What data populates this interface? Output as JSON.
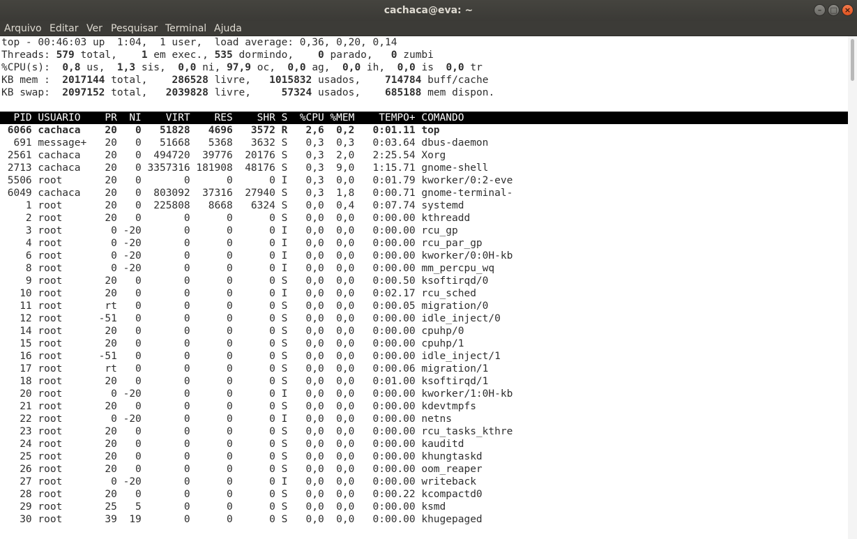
{
  "window": {
    "title": "cachaca@eva: ~",
    "buttons": [
      "minimize",
      "maximize",
      "close"
    ]
  },
  "menu": [
    "Arquivo",
    "Editar",
    "Ver",
    "Pesquisar",
    "Terminal",
    "Ajuda"
  ],
  "top_header": {
    "line1": "top - 00:46:03 up  1:04,  1 user,  load average: 0,36, 0,20, 0,14",
    "threads": {
      "label": "Threads:",
      "total": "579",
      "total_l": "total,",
      "running": "1",
      "running_l": "em exec.,",
      "sleeping": "535",
      "sleeping_l": "dormindo,",
      "stopped": "0",
      "stopped_l": "parado,",
      "zombie": "0",
      "zombie_l": "zumbi"
    },
    "cpu": {
      "label": "%CPU(s):",
      "us": "0,8",
      "sy": "1,3",
      "ni": "0,0",
      "id": "97,9",
      "wa": "0,0",
      "hi": "0,0",
      "si": "0,0",
      "st": "0,0"
    },
    "mem": {
      "label": "KB mem :",
      "total": "2017144",
      "free": "286528",
      "used": "1015832",
      "buff": "714784"
    },
    "swap": {
      "label": "KB swap:",
      "total": "2097152",
      "free": "2039828",
      "used": "57324",
      "avail": "685188"
    }
  },
  "columns": [
    "PID",
    "USUARIO",
    "PR",
    "NI",
    "VIRT",
    "RES",
    "SHR",
    "S",
    "%CPU",
    "%MEM",
    "TEMPO+",
    "COMANDO"
  ],
  "processes": [
    [
      "6066",
      "cachaca",
      "20",
      "0",
      "51828",
      "4696",
      "3572",
      "R",
      "2,6",
      "0,2",
      "0:01.11",
      "top"
    ],
    [
      "691",
      "message+",
      "20",
      "0",
      "51668",
      "5368",
      "3632",
      "S",
      "0,3",
      "0,3",
      "0:03.64",
      "dbus-daemon"
    ],
    [
      "2561",
      "cachaca",
      "20",
      "0",
      "494720",
      "39776",
      "20176",
      "S",
      "0,3",
      "2,0",
      "2:25.54",
      "Xorg"
    ],
    [
      "2713",
      "cachaca",
      "20",
      "0",
      "3357316",
      "181908",
      "48176",
      "S",
      "0,3",
      "9,0",
      "1:15.71",
      "gnome-shell"
    ],
    [
      "5506",
      "root",
      "20",
      "0",
      "0",
      "0",
      "0",
      "I",
      "0,3",
      "0,0",
      "0:01.79",
      "kworker/0:2-eve"
    ],
    [
      "6049",
      "cachaca",
      "20",
      "0",
      "803092",
      "37316",
      "27940",
      "S",
      "0,3",
      "1,8",
      "0:00.71",
      "gnome-terminal-"
    ],
    [
      "1",
      "root",
      "20",
      "0",
      "225808",
      "8668",
      "6324",
      "S",
      "0,0",
      "0,4",
      "0:07.74",
      "systemd"
    ],
    [
      "2",
      "root",
      "20",
      "0",
      "0",
      "0",
      "0",
      "S",
      "0,0",
      "0,0",
      "0:00.00",
      "kthreadd"
    ],
    [
      "3",
      "root",
      "0",
      "-20",
      "0",
      "0",
      "0",
      "I",
      "0,0",
      "0,0",
      "0:00.00",
      "rcu_gp"
    ],
    [
      "4",
      "root",
      "0",
      "-20",
      "0",
      "0",
      "0",
      "I",
      "0,0",
      "0,0",
      "0:00.00",
      "rcu_par_gp"
    ],
    [
      "6",
      "root",
      "0",
      "-20",
      "0",
      "0",
      "0",
      "I",
      "0,0",
      "0,0",
      "0:00.00",
      "kworker/0:0H-kb"
    ],
    [
      "8",
      "root",
      "0",
      "-20",
      "0",
      "0",
      "0",
      "I",
      "0,0",
      "0,0",
      "0:00.00",
      "mm_percpu_wq"
    ],
    [
      "9",
      "root",
      "20",
      "0",
      "0",
      "0",
      "0",
      "S",
      "0,0",
      "0,0",
      "0:00.50",
      "ksoftirqd/0"
    ],
    [
      "10",
      "root",
      "20",
      "0",
      "0",
      "0",
      "0",
      "I",
      "0,0",
      "0,0",
      "0:02.17",
      "rcu_sched"
    ],
    [
      "11",
      "root",
      "rt",
      "0",
      "0",
      "0",
      "0",
      "S",
      "0,0",
      "0,0",
      "0:00.05",
      "migration/0"
    ],
    [
      "12",
      "root",
      "-51",
      "0",
      "0",
      "0",
      "0",
      "S",
      "0,0",
      "0,0",
      "0:00.00",
      "idle_inject/0"
    ],
    [
      "14",
      "root",
      "20",
      "0",
      "0",
      "0",
      "0",
      "S",
      "0,0",
      "0,0",
      "0:00.00",
      "cpuhp/0"
    ],
    [
      "15",
      "root",
      "20",
      "0",
      "0",
      "0",
      "0",
      "S",
      "0,0",
      "0,0",
      "0:00.00",
      "cpuhp/1"
    ],
    [
      "16",
      "root",
      "-51",
      "0",
      "0",
      "0",
      "0",
      "S",
      "0,0",
      "0,0",
      "0:00.00",
      "idle_inject/1"
    ],
    [
      "17",
      "root",
      "rt",
      "0",
      "0",
      "0",
      "0",
      "S",
      "0,0",
      "0,0",
      "0:00.06",
      "migration/1"
    ],
    [
      "18",
      "root",
      "20",
      "0",
      "0",
      "0",
      "0",
      "S",
      "0,0",
      "0,0",
      "0:01.00",
      "ksoftirqd/1"
    ],
    [
      "20",
      "root",
      "0",
      "-20",
      "0",
      "0",
      "0",
      "I",
      "0,0",
      "0,0",
      "0:00.00",
      "kworker/1:0H-kb"
    ],
    [
      "21",
      "root",
      "20",
      "0",
      "0",
      "0",
      "0",
      "S",
      "0,0",
      "0,0",
      "0:00.00",
      "kdevtmpfs"
    ],
    [
      "22",
      "root",
      "0",
      "-20",
      "0",
      "0",
      "0",
      "I",
      "0,0",
      "0,0",
      "0:00.00",
      "netns"
    ],
    [
      "23",
      "root",
      "20",
      "0",
      "0",
      "0",
      "0",
      "S",
      "0,0",
      "0,0",
      "0:00.00",
      "rcu_tasks_kthre"
    ],
    [
      "24",
      "root",
      "20",
      "0",
      "0",
      "0",
      "0",
      "S",
      "0,0",
      "0,0",
      "0:00.00",
      "kauditd"
    ],
    [
      "25",
      "root",
      "20",
      "0",
      "0",
      "0",
      "0",
      "S",
      "0,0",
      "0,0",
      "0:00.00",
      "khungtaskd"
    ],
    [
      "26",
      "root",
      "20",
      "0",
      "0",
      "0",
      "0",
      "S",
      "0,0",
      "0,0",
      "0:00.00",
      "oom_reaper"
    ],
    [
      "27",
      "root",
      "0",
      "-20",
      "0",
      "0",
      "0",
      "I",
      "0,0",
      "0,0",
      "0:00.00",
      "writeback"
    ],
    [
      "28",
      "root",
      "20",
      "0",
      "0",
      "0",
      "0",
      "S",
      "0,0",
      "0,0",
      "0:00.22",
      "kcompactd0"
    ],
    [
      "29",
      "root",
      "25",
      "5",
      "0",
      "0",
      "0",
      "S",
      "0,0",
      "0,0",
      "0:00.00",
      "ksmd"
    ],
    [
      "30",
      "root",
      "39",
      "19",
      "0",
      "0",
      "0",
      "S",
      "0,0",
      "0,0",
      "0:00.00",
      "khugepaged"
    ]
  ],
  "highlighted_pid": "6066"
}
